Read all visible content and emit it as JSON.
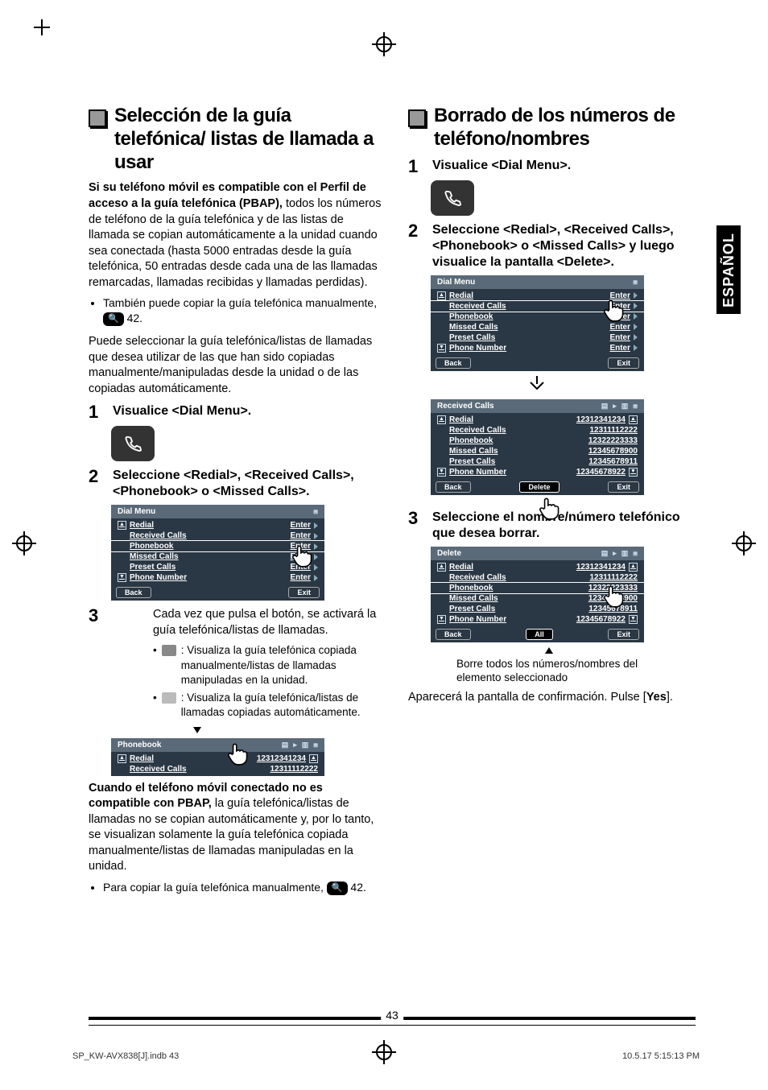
{
  "side_tab": "ESPAÑOL",
  "page_number": "43",
  "footer_left": "SP_KW-AVX838[J].indb   43",
  "footer_right": "10.5.17   5:15:13 PM",
  "left": {
    "title": "Selección de la guía telefónica/ listas de llamada a usar",
    "intro_bold": "Si su teléfono móvil es compatible con el Perfil de acceso a la guía telefónica (PBAP),",
    "intro_rest": " todos los números de teléfono de la guía telefónica y de las listas de llamada se copian automáticamente a la unidad cuando sea conectada (hasta 5000 entradas desde la guía telefónica, 50 entradas desde cada una de las llamadas remarcadas, llamadas recibidas y llamadas perdidas).",
    "bullet1_a": "También puede copiar la guía telefónica manualmente, ",
    "bullet1_b": " 42.",
    "para2": "Puede seleccionar la guía telefónica/listas de llamadas que desea utilizar de las que han sido copiadas manualmente/manipuladas desde la unidad o de las copiadas automáticamente.",
    "step1": "Visualice <Dial Menu>.",
    "step2": "Seleccione <Redial>, <Received Calls>, <Phonebook> o <Missed Calls>.",
    "step3_intro": "Cada vez que pulsa el botón, se activará la guía telefónica/listas de llamadas.",
    "step3_b1": ": Visualiza la guía telefónica copiada manualmente/listas de llamadas manipuladas en la unidad.",
    "step3_b2": ": Visualiza la guía telefónica/listas de llamadas copiadas automáticamente.",
    "pbap_no_bold": "Cuando el teléfono móvil conectado no es compatible con PBAP,",
    "pbap_no_rest": " la guía telefónica/listas de llamadas no se copian automáticamente y, por lo tanto, se visualizan solamente la guía telefónica copiada manualmente/listas de llamadas manipuladas en la unidad.",
    "bullet2_a": "Para copiar la guía telefónica manualmente, ",
    "bullet2_b": " 42.",
    "lcd_a": {
      "title": "Dial Menu",
      "rows": [
        {
          "l": "Redial",
          "r": "Enter"
        },
        {
          "l": "Received Calls",
          "r": "Enter"
        },
        {
          "l": "Phonebook",
          "r": "Enter"
        },
        {
          "l": "Missed Calls",
          "r": "Enter"
        },
        {
          "l": "Preset Calls",
          "r": "Enter"
        },
        {
          "l": "Phone Number",
          "r": "Enter"
        }
      ],
      "back": "Back",
      "exit": "Exit"
    },
    "lcd_b": {
      "title": "Phonebook",
      "rows": [
        {
          "l": "Redial",
          "r": "12312341234"
        },
        {
          "l": "Received Calls",
          "r": "12311112222"
        }
      ]
    }
  },
  "right": {
    "title": "Borrado de los números de teléfono/nombres",
    "step1": "Visualice <Dial Menu>.",
    "step2": "Seleccione <Redial>, <Received Calls>, <Phonebook> o <Missed Calls> y luego visualice la pantalla <Delete>.",
    "step3": "Seleccione el nombre/número telefónico que desea borrar.",
    "caption_all": "Borre todos los números/nombres del elemento seleccionado",
    "confirm_a": "Aparecerá la pantalla de confirmación. Pulse [",
    "confirm_yes": "Yes",
    "confirm_b": "].",
    "lcd_a": {
      "title": "Dial Menu",
      "rows": [
        {
          "l": "Redial",
          "r": "Enter"
        },
        {
          "l": "Received Calls",
          "r": "Enter"
        },
        {
          "l": "Phonebook",
          "r": "Enter"
        },
        {
          "l": "Missed Calls",
          "r": "Enter"
        },
        {
          "l": "Preset Calls",
          "r": "Enter"
        },
        {
          "l": "Phone Number",
          "r": "Enter"
        }
      ],
      "back": "Back",
      "exit": "Exit"
    },
    "lcd_b": {
      "title": "Received Calls",
      "rows": [
        {
          "l": "Redial",
          "r": "12312341234"
        },
        {
          "l": "Received Calls",
          "r": "12311112222"
        },
        {
          "l": "Phonebook",
          "r": "12322223333"
        },
        {
          "l": "Missed Calls",
          "r": "12345678900"
        },
        {
          "l": "Preset Calls",
          "r": "12345678911"
        },
        {
          "l": "Phone Number",
          "r": "12345678922"
        }
      ],
      "back": "Back",
      "delete": "Delete",
      "exit": "Exit"
    },
    "lcd_c": {
      "title": "Delete",
      "rows": [
        {
          "l": "Redial",
          "r": "12312341234"
        },
        {
          "l": "Received Calls",
          "r": "12311112222"
        },
        {
          "l": "Phonebook",
          "r": "12322223333"
        },
        {
          "l": "Missed Calls",
          "r": "12345678900"
        },
        {
          "l": "Preset Calls",
          "r": "12345678911"
        },
        {
          "l": "Phone Number",
          "r": "12345678922"
        }
      ],
      "back": "Back",
      "all": "All",
      "exit": "Exit"
    }
  }
}
